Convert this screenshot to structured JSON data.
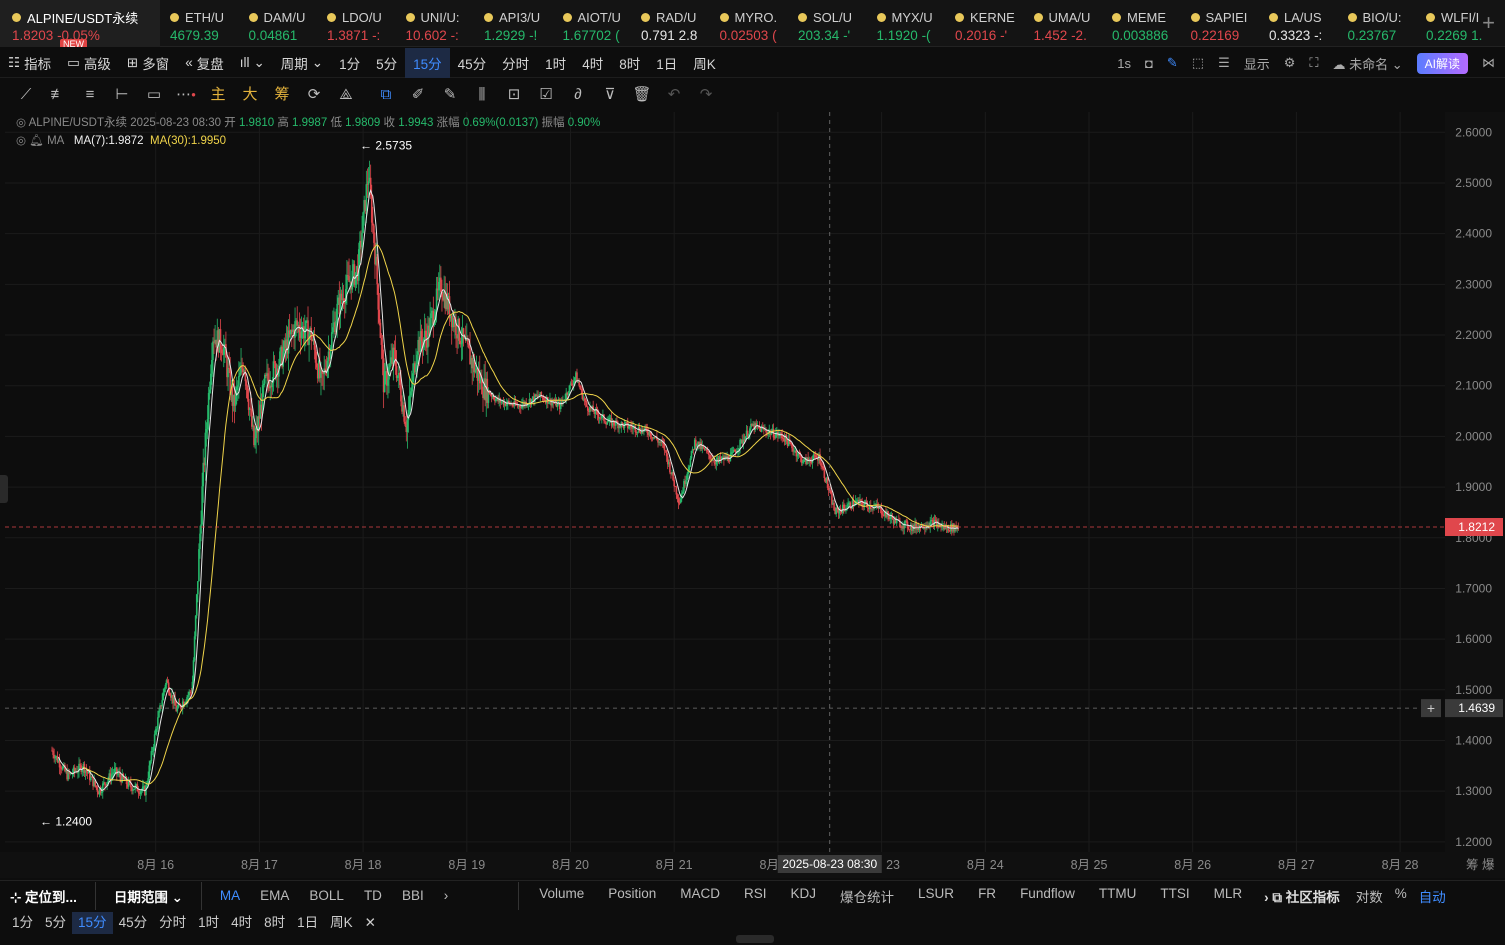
{
  "tickers": [
    {
      "sym": "ALPINE/USDT永续",
      "price": "1.8203",
      "chg": "-0.05%",
      "dir": "dn",
      "badge": "NEW"
    },
    {
      "sym": "ETH/U",
      "price": "4679.39",
      "chg": "",
      "dir": "up"
    },
    {
      "sym": "DAM/U",
      "price": "0.04861",
      "chg": "",
      "dir": "up"
    },
    {
      "sym": "LDO/U",
      "price": "1.3871",
      "chg": "-:",
      "dir": "dn"
    },
    {
      "sym": "UNI/U:",
      "price": "10.602",
      "chg": "-:",
      "dir": "dn"
    },
    {
      "sym": "API3/U",
      "price": "1.2929",
      "chg": "-!",
      "dir": "up"
    },
    {
      "sym": "AIOT/U",
      "price": "1.67702",
      "chg": "(",
      "dir": "up"
    },
    {
      "sym": "RAD/U",
      "price": "0.791",
      "chg": "2.8",
      "dir": "wh"
    },
    {
      "sym": "MYRO.",
      "price": "0.02503",
      "chg": "(",
      "dir": "dn"
    },
    {
      "sym": "SOL/U",
      "price": "203.34",
      "chg": "-'",
      "dir": "up"
    },
    {
      "sym": "MYX/U",
      "price": "1.1920",
      "chg": "-(",
      "dir": "up"
    },
    {
      "sym": "KERNE",
      "price": "0.2016",
      "chg": "-'",
      "dir": "dn"
    },
    {
      "sym": "UMA/U",
      "price": "1.452",
      "chg": "-2.",
      "dir": "dn"
    },
    {
      "sym": "MEME",
      "price": "0.003886",
      "chg": "",
      "dir": "up"
    },
    {
      "sym": "SAPIEI",
      "price": "0.22169",
      "chg": "",
      "dir": "dn"
    },
    {
      "sym": "LA/US",
      "price": "0.3323",
      "chg": "-:",
      "dir": "wh"
    },
    {
      "sym": "BIO/U:",
      "price": "0.23767",
      "chg": "",
      "dir": "up"
    },
    {
      "sym": "WLFI/I",
      "price": "0.2269",
      "chg": "1.",
      "dir": "up"
    }
  ],
  "toolbar": {
    "indicator": "指标",
    "advanced": "高级",
    "multi": "多窗",
    "replay": "复盘",
    "period": "周期",
    "intervals": [
      "1分",
      "5分",
      "15分",
      "45分",
      "分时",
      "1时",
      "4时",
      "8时",
      "1日",
      "周K"
    ],
    "selected_interval": "15分",
    "right": {
      "refresh": "1s",
      "display": "显示",
      "layout": "未命名",
      "ai": "AI解读"
    }
  },
  "drawtools": {
    "main": "主",
    "big": "大",
    "chip": "筹"
  },
  "legend": {
    "symbol": "ALPINE/USDT永续",
    "time": "2025-08-23 08:30",
    "open_l": "开",
    "open": "1.9810",
    "high_l": "高",
    "high": "1.9987",
    "low_l": "低",
    "low": "1.9809",
    "close_l": "收",
    "close": "1.9943",
    "change_l": "涨幅",
    "change": "0.69%(0.0137)",
    "amp_l": "振幅",
    "amp": "0.90%",
    "ma_name": "MA",
    "ma7": "MA(7):1.9872",
    "ma30": "MA(30):1.9950"
  },
  "chart_data": {
    "type": "candlestick",
    "interval": "15m",
    "ylim": [
      1.18,
      2.64
    ],
    "yticks": [
      "2.6000",
      "2.5000",
      "2.4000",
      "2.3000",
      "2.2000",
      "2.1000",
      "2.0000",
      "1.9000",
      "1.8000",
      "1.7000",
      "1.6000",
      "1.5000",
      "1.4000",
      "1.3000",
      "1.2000"
    ],
    "xticks": [
      "8月 16",
      "8月 17",
      "8月 18",
      "8月 19",
      "8月 20",
      "8月 21",
      "8月 22",
      "8月 23",
      "8月 24",
      "8月 25",
      "8月 26",
      "8月 27",
      "8月 28"
    ],
    "crosshair_x": "2025-08-23 08:30",
    "crosshair_price": "1.4639",
    "last_price": "1.8212",
    "high_mark": "← 2.5735",
    "low_mark": "← 1.2400",
    "path_points": [
      [
        0,
        1.38
      ],
      [
        0.15,
        1.33
      ],
      [
        0.3,
        1.35
      ],
      [
        0.45,
        1.3
      ],
      [
        0.6,
        1.34
      ],
      [
        0.75,
        1.31
      ],
      [
        0.9,
        1.3
      ],
      [
        1.0,
        1.42
      ],
      [
        1.1,
        1.52
      ],
      [
        1.2,
        1.46
      ],
      [
        1.35,
        1.5
      ],
      [
        1.45,
        1.9
      ],
      [
        1.55,
        2.2
      ],
      [
        1.65,
        2.18
      ],
      [
        1.75,
        2.06
      ],
      [
        1.85,
        2.15
      ],
      [
        1.95,
        1.98
      ],
      [
        2.05,
        2.1
      ],
      [
        2.2,
        2.15
      ],
      [
        2.35,
        2.22
      ],
      [
        2.5,
        2.2
      ],
      [
        2.6,
        2.1
      ],
      [
        2.75,
        2.25
      ],
      [
        2.85,
        2.3
      ],
      [
        2.95,
        2.33
      ],
      [
        3.05,
        2.52
      ],
      [
        3.12,
        2.35
      ],
      [
        3.2,
        2.1
      ],
      [
        3.3,
        2.16
      ],
      [
        3.42,
        2.02
      ],
      [
        3.52,
        2.18
      ],
      [
        3.62,
        2.2
      ],
      [
        3.75,
        2.3
      ],
      [
        3.85,
        2.24
      ],
      [
        4.0,
        2.17
      ],
      [
        4.15,
        2.1
      ],
      [
        4.3,
        2.07
      ],
      [
        4.5,
        2.06
      ],
      [
        4.7,
        2.08
      ],
      [
        4.9,
        2.06
      ],
      [
        5.05,
        2.12
      ],
      [
        5.15,
        2.06
      ],
      [
        5.35,
        2.03
      ],
      [
        5.55,
        2.02
      ],
      [
        5.75,
        2.01
      ],
      [
        5.9,
        1.98
      ],
      [
        6.05,
        1.87
      ],
      [
        6.2,
        1.99
      ],
      [
        6.4,
        1.95
      ],
      [
        6.55,
        1.96
      ],
      [
        6.75,
        2.02
      ],
      [
        6.9,
        2.01
      ],
      [
        7.05,
        2.0
      ],
      [
        7.25,
        1.95
      ],
      [
        7.4,
        1.96
      ],
      [
        7.55,
        1.85
      ],
      [
        7.75,
        1.87
      ],
      [
        7.95,
        1.86
      ],
      [
        8.15,
        1.83
      ],
      [
        8.3,
        1.82
      ],
      [
        8.5,
        1.83
      ],
      [
        8.6,
        1.82
      ],
      [
        8.75,
        1.82
      ]
    ]
  }
}
